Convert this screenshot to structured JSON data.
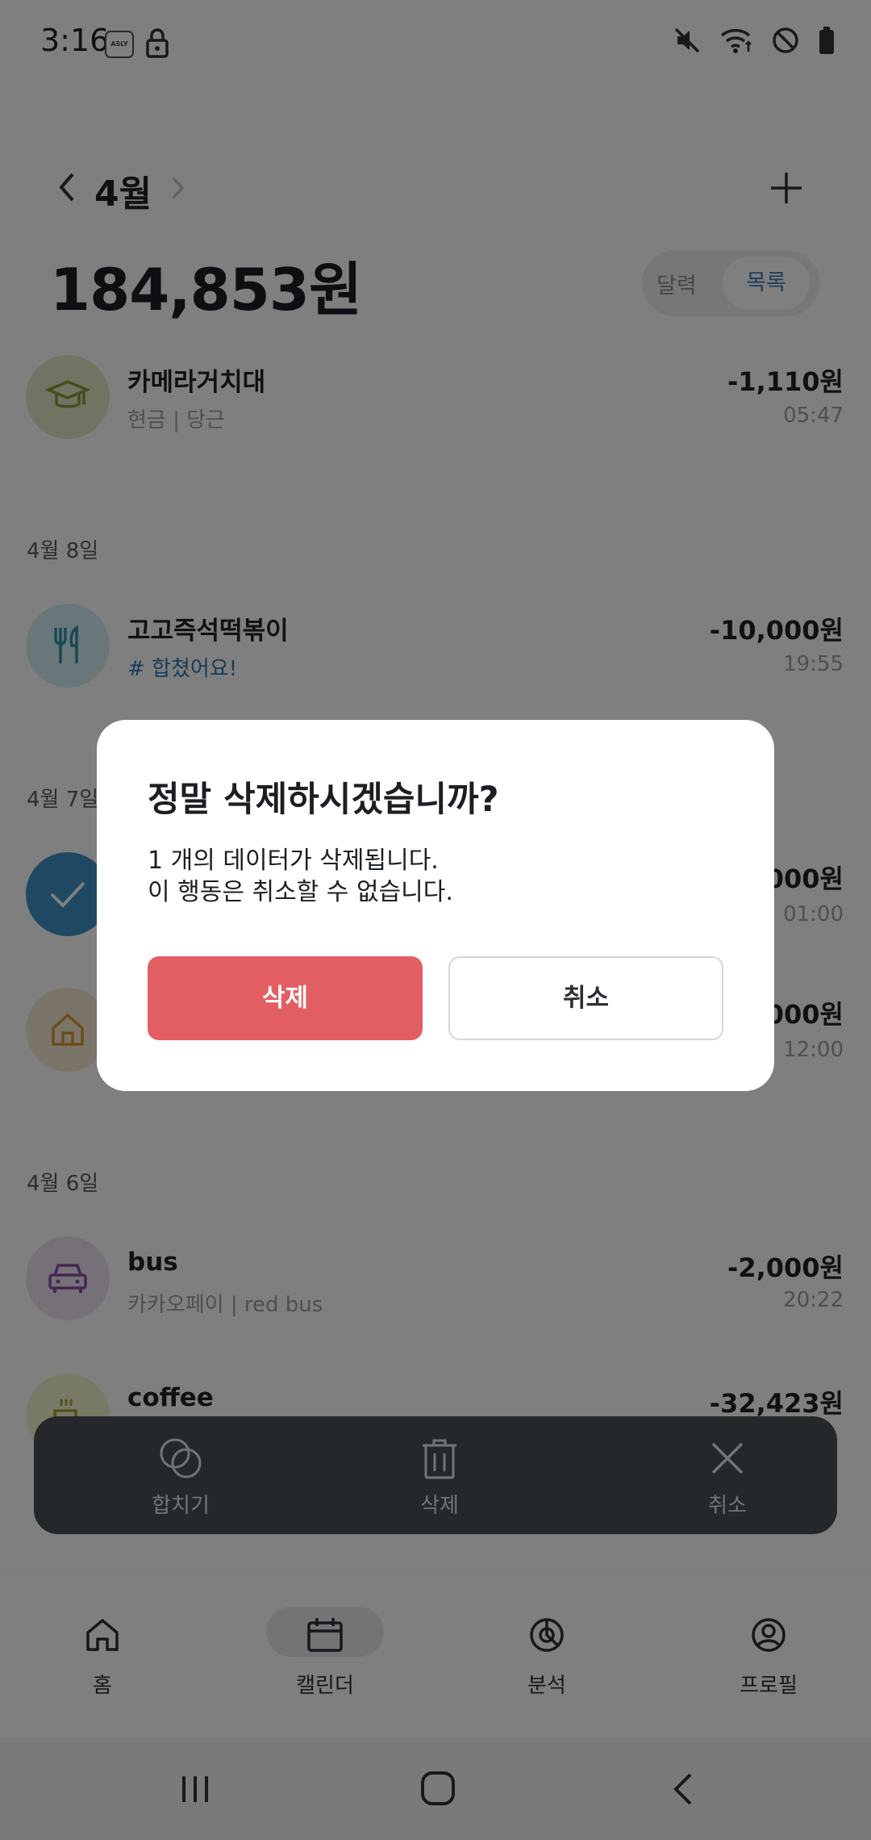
{
  "status_bar": {
    "time": "3:16",
    "app_icon_text": "ASLY",
    "icons": [
      "lock-icon",
      "mute-icon",
      "wifi-icon",
      "do-not-disturb-icon",
      "battery-icon"
    ]
  },
  "header": {
    "month": "4월",
    "total": "184,853원",
    "toggle": {
      "calendar": "달력",
      "list": "목록",
      "selected": "목록"
    }
  },
  "transactions": [
    {
      "title": "카메라거치대",
      "sub": "현금 | 당근",
      "amount": "-1,110원",
      "time": "05:47",
      "icon": "graduation-cap-icon",
      "color": "#e2e8c6"
    },
    {
      "date": "4월 8일"
    },
    {
      "title": "고고즉석떡볶이",
      "sub": "# 합쳤어요!",
      "amount": "-10,000원",
      "time": "19:55",
      "icon": "fork-knife-icon",
      "color": "#d3eef6"
    },
    {
      "date": "4월 7일"
    },
    {
      "title": "",
      "sub": "",
      "amount": "000원",
      "time": "01:00",
      "icon": "check-icon",
      "color": "#3e93c4"
    },
    {
      "title": "",
      "sub": "",
      "amount": "000원",
      "time": "12:00",
      "icon": "house-icon",
      "color": "#f6ead3"
    },
    {
      "date": "4월 6일"
    },
    {
      "title": "bus",
      "sub": "카카오페이 | red bus",
      "amount": "-2,000원",
      "time": "20:22",
      "icon": "car-icon",
      "color": "#ece1f1"
    },
    {
      "title": "coffee",
      "sub": "",
      "amount": "-32,423원",
      "time": "",
      "icon": "coffee-icon",
      "color": "#f3f2cf"
    }
  ],
  "action_bar": {
    "merge": "합치기",
    "delete": "삭제",
    "cancel": "취소"
  },
  "bottom_nav": {
    "home": "홈",
    "calendar": "캘린더",
    "analysis": "분석",
    "profile": "프로필",
    "active": "캘린더"
  },
  "dialog": {
    "title": "정말 삭제하시겠습니까?",
    "line1": "1 개의 데이터가 삭제됩니다.",
    "line2": "이 행동은 취소할 수 없습니다.",
    "confirm": "삭제",
    "cancel": "취소"
  },
  "colors": {
    "accent_blue": "#2f78b0",
    "delete_red": "#e25e63",
    "action_bar_bg": "#4a5057"
  }
}
